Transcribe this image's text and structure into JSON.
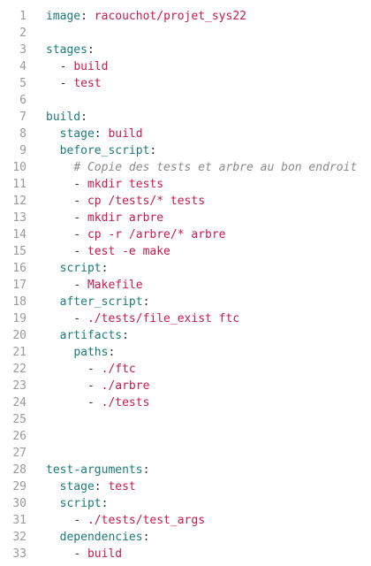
{
  "colors": {
    "key": "#1d7a7a",
    "value": "#c41a4e",
    "punct": "#333333",
    "comment": "#8a8a8a",
    "line_number": "#9a9a9a",
    "background": "#ffffff"
  },
  "lines": [
    {
      "n": "1",
      "tokens": [
        {
          "t": "k",
          "v": "image"
        },
        {
          "t": "p",
          "v": ": "
        },
        {
          "t": "s",
          "v": "racouchot/projet_sys22"
        }
      ]
    },
    {
      "n": "2",
      "tokens": []
    },
    {
      "n": "3",
      "tokens": [
        {
          "t": "k",
          "v": "stages"
        },
        {
          "t": "p",
          "v": ":"
        }
      ]
    },
    {
      "n": "4",
      "tokens": [
        {
          "t": "p",
          "v": "  - "
        },
        {
          "t": "s",
          "v": "build"
        }
      ]
    },
    {
      "n": "5",
      "tokens": [
        {
          "t": "p",
          "v": "  - "
        },
        {
          "t": "s",
          "v": "test"
        }
      ]
    },
    {
      "n": "6",
      "tokens": []
    },
    {
      "n": "7",
      "tokens": [
        {
          "t": "k",
          "v": "build"
        },
        {
          "t": "p",
          "v": ":"
        }
      ]
    },
    {
      "n": "8",
      "tokens": [
        {
          "t": "p",
          "v": "  "
        },
        {
          "t": "k",
          "v": "stage"
        },
        {
          "t": "p",
          "v": ": "
        },
        {
          "t": "s",
          "v": "build"
        }
      ]
    },
    {
      "n": "9",
      "tokens": [
        {
          "t": "p",
          "v": "  "
        },
        {
          "t": "k",
          "v": "before_script"
        },
        {
          "t": "p",
          "v": ":"
        }
      ]
    },
    {
      "n": "10",
      "tokens": [
        {
          "t": "p",
          "v": "    "
        },
        {
          "t": "c",
          "v": "# Copie des tests et arbre au bon endroit"
        }
      ]
    },
    {
      "n": "11",
      "tokens": [
        {
          "t": "p",
          "v": "    - "
        },
        {
          "t": "s",
          "v": "mkdir tests"
        }
      ]
    },
    {
      "n": "12",
      "tokens": [
        {
          "t": "p",
          "v": "    - "
        },
        {
          "t": "s",
          "v": "cp /tests/* tests"
        }
      ]
    },
    {
      "n": "13",
      "tokens": [
        {
          "t": "p",
          "v": "    - "
        },
        {
          "t": "s",
          "v": "mkdir arbre"
        }
      ]
    },
    {
      "n": "14",
      "tokens": [
        {
          "t": "p",
          "v": "    - "
        },
        {
          "t": "s",
          "v": "cp -r /arbre/* arbre"
        }
      ]
    },
    {
      "n": "15",
      "tokens": [
        {
          "t": "p",
          "v": "    - "
        },
        {
          "t": "s",
          "v": "test -e make"
        }
      ]
    },
    {
      "n": "16",
      "tokens": [
        {
          "t": "p",
          "v": "  "
        },
        {
          "t": "k",
          "v": "script"
        },
        {
          "t": "p",
          "v": ":"
        }
      ]
    },
    {
      "n": "17",
      "tokens": [
        {
          "t": "p",
          "v": "    - "
        },
        {
          "t": "s",
          "v": "Makefile"
        }
      ]
    },
    {
      "n": "18",
      "tokens": [
        {
          "t": "p",
          "v": "  "
        },
        {
          "t": "k",
          "v": "after_script"
        },
        {
          "t": "p",
          "v": ":"
        }
      ]
    },
    {
      "n": "19",
      "tokens": [
        {
          "t": "p",
          "v": "    - "
        },
        {
          "t": "s",
          "v": "./tests/file_exist ftc"
        }
      ]
    },
    {
      "n": "20",
      "tokens": [
        {
          "t": "p",
          "v": "  "
        },
        {
          "t": "k",
          "v": "artifacts"
        },
        {
          "t": "p",
          "v": ":"
        }
      ]
    },
    {
      "n": "21",
      "tokens": [
        {
          "t": "p",
          "v": "    "
        },
        {
          "t": "k",
          "v": "paths"
        },
        {
          "t": "p",
          "v": ":"
        }
      ]
    },
    {
      "n": "22",
      "tokens": [
        {
          "t": "p",
          "v": "      - "
        },
        {
          "t": "s",
          "v": "./ftc"
        }
      ]
    },
    {
      "n": "23",
      "tokens": [
        {
          "t": "p",
          "v": "      - "
        },
        {
          "t": "s",
          "v": "./arbre"
        }
      ]
    },
    {
      "n": "24",
      "tokens": [
        {
          "t": "p",
          "v": "      - "
        },
        {
          "t": "s",
          "v": "./tests"
        }
      ]
    },
    {
      "n": "25",
      "tokens": []
    },
    {
      "n": "26",
      "tokens": []
    },
    {
      "n": "27",
      "tokens": []
    },
    {
      "n": "28",
      "tokens": [
        {
          "t": "k",
          "v": "test-arguments"
        },
        {
          "t": "p",
          "v": ":"
        }
      ]
    },
    {
      "n": "29",
      "tokens": [
        {
          "t": "p",
          "v": "  "
        },
        {
          "t": "k",
          "v": "stage"
        },
        {
          "t": "p",
          "v": ": "
        },
        {
          "t": "s",
          "v": "test"
        }
      ]
    },
    {
      "n": "30",
      "tokens": [
        {
          "t": "p",
          "v": "  "
        },
        {
          "t": "k",
          "v": "script"
        },
        {
          "t": "p",
          "v": ":"
        }
      ]
    },
    {
      "n": "31",
      "tokens": [
        {
          "t": "p",
          "v": "    - "
        },
        {
          "t": "s",
          "v": "./tests/test_args"
        }
      ]
    },
    {
      "n": "32",
      "tokens": [
        {
          "t": "p",
          "v": "  "
        },
        {
          "t": "k",
          "v": "dependencies"
        },
        {
          "t": "p",
          "v": ":"
        }
      ]
    },
    {
      "n": "33",
      "tokens": [
        {
          "t": "p",
          "v": "    - "
        },
        {
          "t": "s",
          "v": "build"
        }
      ]
    }
  ]
}
